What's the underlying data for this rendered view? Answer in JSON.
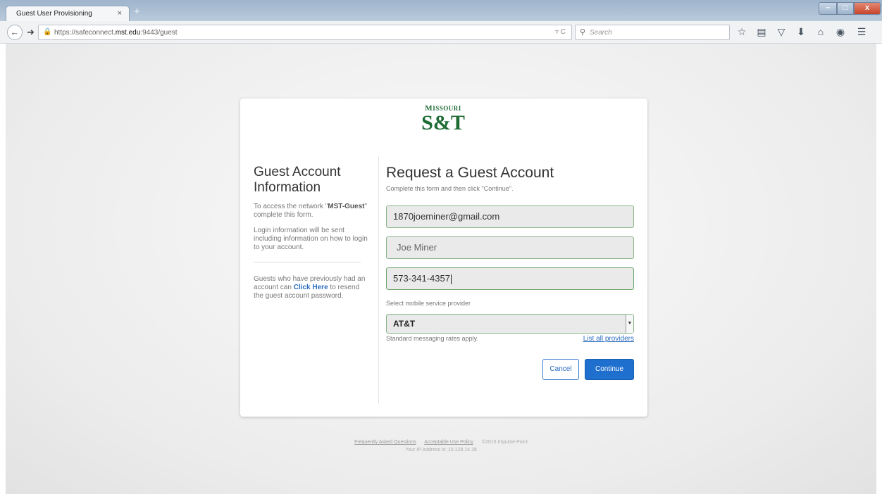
{
  "browser": {
    "tab_title": "Guest User Provisioning",
    "tab_close": "×",
    "new_tab": "+",
    "url_prefix": "https://safeconnect.",
    "url_domain": "mst.edu",
    "url_suffix": ":9443/guest",
    "url_tools": "▿ C",
    "search_placeholder": "Search",
    "window_controls": {
      "minimize": "‒",
      "maximize": "□",
      "close": "x"
    }
  },
  "logo": {
    "line1_a": "M",
    "line1_b": "ISSOURI",
    "line2": "S&T"
  },
  "info": {
    "title": "Guest Account Information",
    "p1_a": "To access the network \"",
    "p1_b": "MST-Guest",
    "p1_c": "\" complete this form.",
    "p2": "Login information will be sent including information on how to login to your account.",
    "p3_a": "Guests who have previously had an account can ",
    "p3_link": "Click Here",
    "p3_b": " to resend the guest account password."
  },
  "form": {
    "title": "Request a Guest Account",
    "subtitle": "Complete this form and then click \"Continue\".",
    "email": "1870joeminer@gmail.com",
    "name": "Joe Miner",
    "phone": "573-341-4357",
    "provider_label": "Select mobile service provider",
    "provider_selected": "AT&T",
    "rates_note": "Standard messaging rates apply.",
    "list_providers": "List all providers",
    "cancel_label": "Cancel",
    "continue_label": "Continue"
  },
  "footer": {
    "faq": "Frequently Asked Questions",
    "aup": "Acceptable Use Policy",
    "copyright": "©2015 Impulse Point",
    "ip_line": "Your IP Address is: 10.128.14.18"
  },
  "colors": {
    "accent": "#1e6fce",
    "logo_green": "#1e6b34",
    "field_border": "#88b589"
  }
}
